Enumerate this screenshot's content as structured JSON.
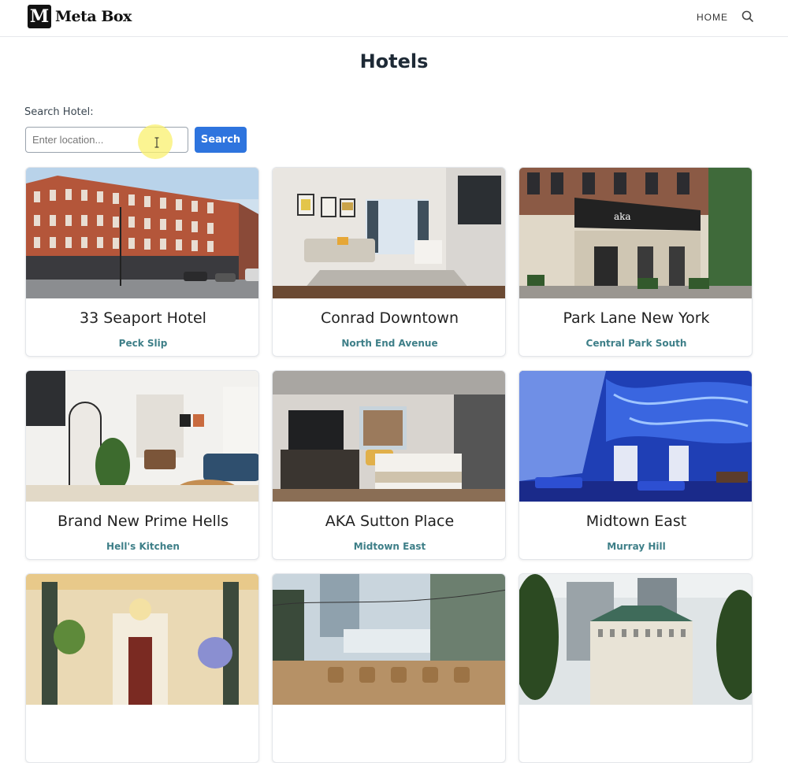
{
  "brand": {
    "letter": "M",
    "name": "Meta Box"
  },
  "nav": {
    "home_label": "HOME",
    "search_icon": "search-icon"
  },
  "page": {
    "title": "Hotels"
  },
  "search": {
    "label": "Search Hotel:",
    "placeholder": "Enter location...",
    "value": "",
    "button_label": "Search"
  },
  "colors": {
    "accent": "#2e74de",
    "location_text": "#3e7f88",
    "title_text": "#1e2a36"
  },
  "hotels": [
    {
      "name": "33 Seaport Hotel",
      "location": "Peck Slip"
    },
    {
      "name": "Conrad Downtown",
      "location": "North End Avenue"
    },
    {
      "name": "Park Lane New York",
      "location": "Central Park South"
    },
    {
      "name": "Brand New Prime Hells",
      "location": "Hell's Kitchen"
    },
    {
      "name": "AKA Sutton Place",
      "location": "Midtown East"
    },
    {
      "name": "Midtown East",
      "location": "Murray Hill"
    },
    {
      "name": "",
      "location": ""
    },
    {
      "name": "",
      "location": ""
    },
    {
      "name": "",
      "location": ""
    }
  ]
}
